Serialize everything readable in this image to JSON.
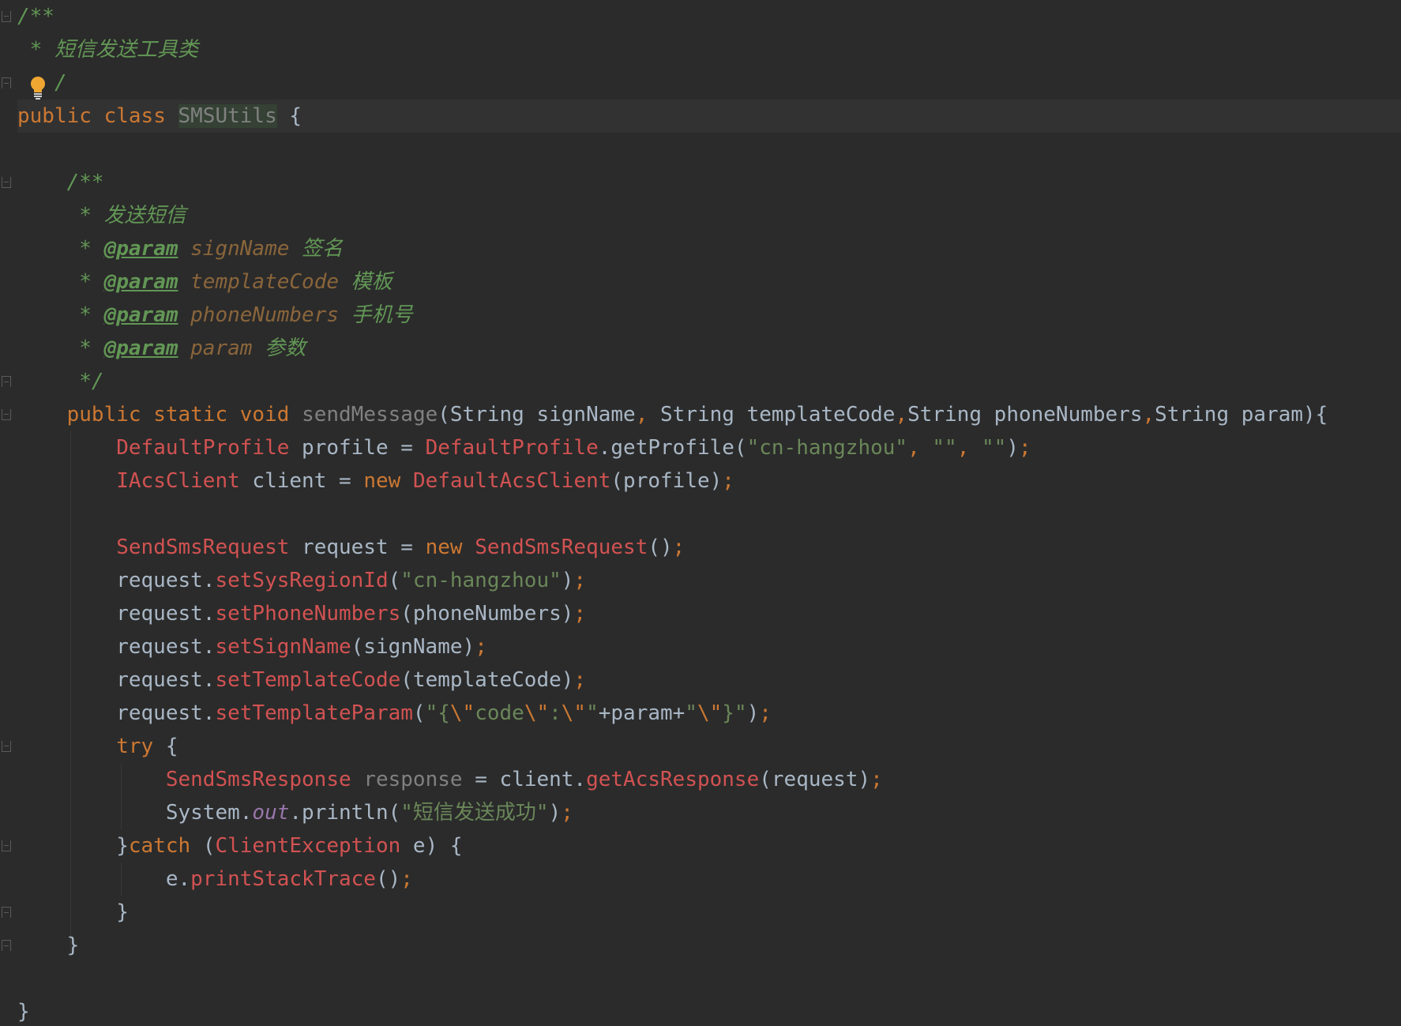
{
  "colors": {
    "background": "#2b2b2b",
    "keyword": "#cc7832",
    "comment": "#629755",
    "error_class": "#d25252",
    "string": "#6a8759",
    "plain": "#a9b7c6",
    "static_field": "#9876aa",
    "unused": "#808080"
  },
  "icons": {
    "bulb": "lightbulb-icon",
    "fold": "fold-marker-icon"
  },
  "lines": [
    {
      "tokens": [
        {
          "t": "/**",
          "c": "cm"
        }
      ]
    },
    {
      "tokens": [
        {
          "t": " * ",
          "c": "cm"
        },
        {
          "t": "短信发送工具类",
          "c": "cm-text"
        }
      ]
    },
    {
      "tokens": [
        {
          "t": "   ",
          "c": "plain"
        },
        {
          "t": "/",
          "c": "cm"
        }
      ]
    },
    {
      "tokens": [
        {
          "t": "public ",
          "c": "kw"
        },
        {
          "t": "class ",
          "c": "kw"
        },
        {
          "t": "SMSUtils",
          "c": "cls-hl"
        },
        {
          "t": " {",
          "c": "plain"
        }
      ],
      "current": true
    },
    {
      "tokens": []
    },
    {
      "tokens": [
        {
          "t": "    /**",
          "c": "cm"
        }
      ]
    },
    {
      "tokens": [
        {
          "t": "     * ",
          "c": "cm"
        },
        {
          "t": "发送短信",
          "c": "cm-text"
        }
      ]
    },
    {
      "tokens": [
        {
          "t": "     * ",
          "c": "cm"
        },
        {
          "t": "@param",
          "c": "cm-tag"
        },
        {
          "t": " ",
          "c": "cm"
        },
        {
          "t": "signName",
          "c": "cm-param"
        },
        {
          "t": " 签名",
          "c": "cm-text"
        }
      ]
    },
    {
      "tokens": [
        {
          "t": "     * ",
          "c": "cm"
        },
        {
          "t": "@param",
          "c": "cm-tag"
        },
        {
          "t": " ",
          "c": "cm"
        },
        {
          "t": "templateCode",
          "c": "cm-param"
        },
        {
          "t": " 模板",
          "c": "cm-text"
        }
      ]
    },
    {
      "tokens": [
        {
          "t": "     * ",
          "c": "cm"
        },
        {
          "t": "@param",
          "c": "cm-tag"
        },
        {
          "t": " ",
          "c": "cm"
        },
        {
          "t": "phoneNumbers",
          "c": "cm-param"
        },
        {
          "t": " 手机号",
          "c": "cm-text"
        }
      ]
    },
    {
      "tokens": [
        {
          "t": "     * ",
          "c": "cm"
        },
        {
          "t": "@param",
          "c": "cm-tag"
        },
        {
          "t": " ",
          "c": "cm"
        },
        {
          "t": "param",
          "c": "cm-param"
        },
        {
          "t": " 参数",
          "c": "cm-text"
        }
      ]
    },
    {
      "tokens": [
        {
          "t": "     */",
          "c": "cm"
        }
      ]
    },
    {
      "tokens": [
        {
          "t": "    ",
          "c": "plain"
        },
        {
          "t": "public ",
          "c": "kw"
        },
        {
          "t": "static ",
          "c": "kw"
        },
        {
          "t": "void ",
          "c": "kw"
        },
        {
          "t": "sendMessage",
          "c": "gray"
        },
        {
          "t": "(String signName",
          "c": "plain"
        },
        {
          "t": ", ",
          "c": "punc"
        },
        {
          "t": "String templateCode",
          "c": "plain"
        },
        {
          "t": ",",
          "c": "punc"
        },
        {
          "t": "String phoneNumbers",
          "c": "plain"
        },
        {
          "t": ",",
          "c": "punc"
        },
        {
          "t": "String param){",
          "c": "plain"
        }
      ]
    },
    {
      "tokens": [
        {
          "t": "        ",
          "c": "plain"
        },
        {
          "t": "DefaultProfile",
          "c": "err"
        },
        {
          "t": " profile = ",
          "c": "plain"
        },
        {
          "t": "DefaultProfile",
          "c": "err"
        },
        {
          "t": ".getProfile(",
          "c": "plain"
        },
        {
          "t": "\"cn-hangzhou\"",
          "c": "str"
        },
        {
          "t": ", ",
          "c": "punc"
        },
        {
          "t": "\"\"",
          "c": "str"
        },
        {
          "t": ", ",
          "c": "punc"
        },
        {
          "t": "\"\"",
          "c": "str"
        },
        {
          "t": ")",
          "c": "plain"
        },
        {
          "t": ";",
          "c": "punc"
        }
      ]
    },
    {
      "tokens": [
        {
          "t": "        ",
          "c": "plain"
        },
        {
          "t": "IAcsClient",
          "c": "err"
        },
        {
          "t": " client = ",
          "c": "plain"
        },
        {
          "t": "new ",
          "c": "kw"
        },
        {
          "t": "DefaultAcsClient",
          "c": "err"
        },
        {
          "t": "(profile)",
          "c": "plain"
        },
        {
          "t": ";",
          "c": "punc"
        }
      ]
    },
    {
      "tokens": []
    },
    {
      "tokens": [
        {
          "t": "        ",
          "c": "plain"
        },
        {
          "t": "SendSmsRequest",
          "c": "err"
        },
        {
          "t": " request = ",
          "c": "plain"
        },
        {
          "t": "new ",
          "c": "kw"
        },
        {
          "t": "SendSmsRequest",
          "c": "err"
        },
        {
          "t": "()",
          "c": "plain"
        },
        {
          "t": ";",
          "c": "punc"
        }
      ]
    },
    {
      "tokens": [
        {
          "t": "        request.",
          "c": "plain"
        },
        {
          "t": "setSysRegionId",
          "c": "err"
        },
        {
          "t": "(",
          "c": "plain"
        },
        {
          "t": "\"cn-hangzhou\"",
          "c": "str"
        },
        {
          "t": ")",
          "c": "plain"
        },
        {
          "t": ";",
          "c": "punc"
        }
      ]
    },
    {
      "tokens": [
        {
          "t": "        request.",
          "c": "plain"
        },
        {
          "t": "setPhoneNumbers",
          "c": "err"
        },
        {
          "t": "(phoneNumbers)",
          "c": "plain"
        },
        {
          "t": ";",
          "c": "punc"
        }
      ]
    },
    {
      "tokens": [
        {
          "t": "        request.",
          "c": "plain"
        },
        {
          "t": "setSignName",
          "c": "err"
        },
        {
          "t": "(signName)",
          "c": "plain"
        },
        {
          "t": ";",
          "c": "punc"
        }
      ]
    },
    {
      "tokens": [
        {
          "t": "        request.",
          "c": "plain"
        },
        {
          "t": "setTemplateCode",
          "c": "err"
        },
        {
          "t": "(templateCode)",
          "c": "plain"
        },
        {
          "t": ";",
          "c": "punc"
        }
      ]
    },
    {
      "tokens": [
        {
          "t": "        request.",
          "c": "plain"
        },
        {
          "t": "setTemplateParam",
          "c": "err"
        },
        {
          "t": "(",
          "c": "plain"
        },
        {
          "t": "\"{",
          "c": "str"
        },
        {
          "t": "\\\"",
          "c": "esc"
        },
        {
          "t": "code",
          "c": "str"
        },
        {
          "t": "\\\"",
          "c": "esc"
        },
        {
          "t": ":",
          "c": "str"
        },
        {
          "t": "\\\"",
          "c": "esc"
        },
        {
          "t": "\"",
          "c": "str"
        },
        {
          "t": "+param+",
          "c": "plain"
        },
        {
          "t": "\"",
          "c": "str"
        },
        {
          "t": "\\\"",
          "c": "esc"
        },
        {
          "t": "}\"",
          "c": "str"
        },
        {
          "t": ")",
          "c": "plain"
        },
        {
          "t": ";",
          "c": "punc"
        }
      ]
    },
    {
      "tokens": [
        {
          "t": "        ",
          "c": "plain"
        },
        {
          "t": "try ",
          "c": "kw"
        },
        {
          "t": "{",
          "c": "plain"
        }
      ]
    },
    {
      "tokens": [
        {
          "t": "            ",
          "c": "plain"
        },
        {
          "t": "SendSmsResponse",
          "c": "err"
        },
        {
          "t": " ",
          "c": "plain"
        },
        {
          "t": "response",
          "c": "gray"
        },
        {
          "t": " = client.",
          "c": "plain"
        },
        {
          "t": "getAcsResponse",
          "c": "err"
        },
        {
          "t": "(request)",
          "c": "plain"
        },
        {
          "t": ";",
          "c": "punc"
        }
      ]
    },
    {
      "tokens": [
        {
          "t": "            System.",
          "c": "plain"
        },
        {
          "t": "out",
          "c": "fld"
        },
        {
          "t": ".println(",
          "c": "plain"
        },
        {
          "t": "\"短信发送成功\"",
          "c": "str"
        },
        {
          "t": ")",
          "c": "plain"
        },
        {
          "t": ";",
          "c": "punc"
        }
      ]
    },
    {
      "tokens": [
        {
          "t": "        }",
          "c": "plain"
        },
        {
          "t": "catch ",
          "c": "kw"
        },
        {
          "t": "(",
          "c": "plain"
        },
        {
          "t": "ClientException",
          "c": "err"
        },
        {
          "t": " e) {",
          "c": "plain"
        }
      ]
    },
    {
      "tokens": [
        {
          "t": "            e.",
          "c": "plain"
        },
        {
          "t": "printStackTrace",
          "c": "err"
        },
        {
          "t": "()",
          "c": "plain"
        },
        {
          "t": ";",
          "c": "punc"
        }
      ]
    },
    {
      "tokens": [
        {
          "t": "        }",
          "c": "plain"
        }
      ]
    },
    {
      "tokens": [
        {
          "t": "    }",
          "c": "plain"
        }
      ]
    },
    {
      "tokens": []
    },
    {
      "tokens": [
        {
          "t": "}",
          "c": "plain"
        }
      ]
    }
  ]
}
